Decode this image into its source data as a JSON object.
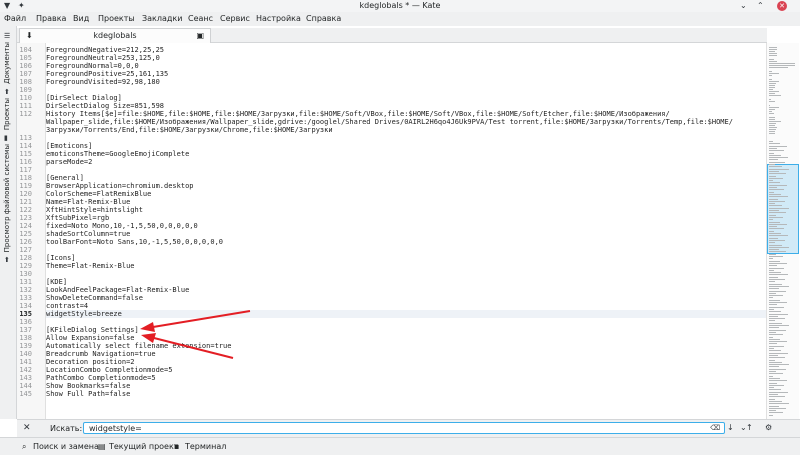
{
  "window": {
    "title": "kdeglobals * — Kate"
  },
  "menu": [
    "Файл",
    "Правка",
    "Вид",
    "Проекты",
    "Закладки",
    "Сеанс",
    "Сервис",
    "Настройка",
    "Справка"
  ],
  "side_tabs": {
    "documents": "Документы",
    "projects": "Проекты",
    "filesystem": "Просмотр файловой системы"
  },
  "tab": {
    "name": "kdeglobals"
  },
  "lines": [
    {
      "n": "104",
      "text": "ForegroundNegative=212,25,25"
    },
    {
      "n": "105",
      "text": "ForegroundNeutral=253,125,0"
    },
    {
      "n": "106",
      "text": "ForegroundNormal=0,0,0"
    },
    {
      "n": "107",
      "text": "ForegroundPositive=25,161,135"
    },
    {
      "n": "108",
      "text": "ForegroundVisited=92,98,180"
    },
    {
      "n": "109",
      "text": ""
    },
    {
      "n": "110",
      "text": "[DirSelect Dialog]"
    },
    {
      "n": "111",
      "text": "DirSelectDialog Size=851,598"
    },
    {
      "n": "112",
      "text": "History Items[$e]=file:$HOME,file:$HOME,file:$HOME/Загрузки,file:$HOME/Soft/VBox,file:$HOME/Soft/VBox,file:$HOME/Soft/Etcher,file:$HOME/Изображения/"
    },
    {
      "n": "",
      "text": "Wallpaper_slide,file:$HOME/Изображения/Wallpaper_slide,gdrive:/googlel/Shared Drives/0AIRL2H6qo4J6Uk9PVA/Test torrent,file:$HOME/Загрузки/Torrents/Temp,file:$HOME/"
    },
    {
      "n": "",
      "text": "Загрузки/Torrents/End,file:$HOME/Загрузки/Chrome,file:$HOME/Загрузки"
    },
    {
      "n": "113",
      "text": ""
    },
    {
      "n": "114",
      "text": "[Emoticons]"
    },
    {
      "n": "115",
      "text": "emoticonsTheme=GoogleEmojiComplete"
    },
    {
      "n": "116",
      "text": "parseMode=2"
    },
    {
      "n": "117",
      "text": ""
    },
    {
      "n": "118",
      "text": "[General]"
    },
    {
      "n": "119",
      "text": "BrowserApplication=chromium.desktop"
    },
    {
      "n": "120",
      "text": "ColorScheme=FlatRemixBlue"
    },
    {
      "n": "121",
      "text": "Name=Flat-Remix-Blue"
    },
    {
      "n": "122",
      "text": "XftHintStyle=hintslight"
    },
    {
      "n": "123",
      "text": "XftSubPixel=rgb"
    },
    {
      "n": "124",
      "text": "fixed=Noto Mono,10,-1,5,50,0,0,0,0,0"
    },
    {
      "n": "125",
      "text": "shadeSortColumn=true"
    },
    {
      "n": "126",
      "text": "toolBarFont=Noto Sans,10,-1,5,50,0,0,0,0,0"
    },
    {
      "n": "127",
      "text": ""
    },
    {
      "n": "128",
      "text": "[Icons]"
    },
    {
      "n": "129",
      "text": "Theme=Flat-Remix-Blue"
    },
    {
      "n": "130",
      "text": ""
    },
    {
      "n": "131",
      "text": "[KDE]"
    },
    {
      "n": "132",
      "text": "LookAndFeelPackage=Flat-Remix-Blue"
    },
    {
      "n": "133",
      "text": "ShowDeleteCommand=false"
    },
    {
      "n": "134",
      "text": "contrast=4"
    },
    {
      "n": "135",
      "text": "widgetStyle=breeze"
    },
    {
      "n": "136",
      "text": ""
    },
    {
      "n": "137",
      "text": "[KFileDialog Settings]"
    },
    {
      "n": "138",
      "text": "Allow Expansion=false"
    },
    {
      "n": "139",
      "text": "Automatically select filename extension=true"
    },
    {
      "n": "140",
      "text": "Breadcrumb Navigation=true"
    },
    {
      "n": "141",
      "text": "Decoration position=2"
    },
    {
      "n": "142",
      "text": "LocationCombo Completionmode=5"
    },
    {
      "n": "143",
      "text": "PathCombo Completionmode=5"
    },
    {
      "n": "144",
      "text": "Show Bookmarks=false"
    },
    {
      "n": "145",
      "text": "Show Full Path=false"
    }
  ],
  "current_line": "135",
  "search": {
    "label": "Искать:",
    "value": "widgetstyle="
  },
  "bottom": {
    "search_replace": "Поиск и замена",
    "current_project": "Текущий проект",
    "terminal": "Терминал"
  },
  "colors": {
    "accent": "#3daee9",
    "annotation": "#e31e24"
  }
}
